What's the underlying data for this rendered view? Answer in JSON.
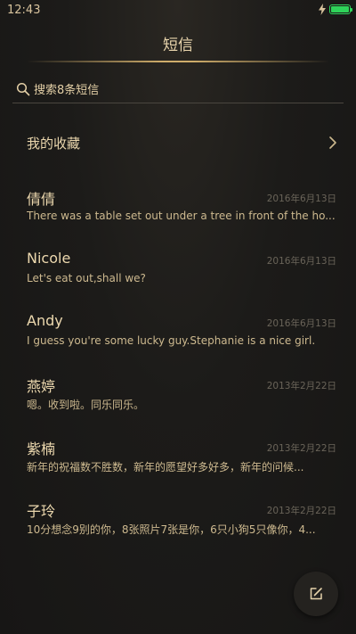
{
  "status_bar": {
    "time": "12:43",
    "battery_level": 1.0,
    "charging": true,
    "battery_color": "#2fd35a"
  },
  "header": {
    "title": "短信"
  },
  "search": {
    "placeholder": "搜索8条短信",
    "icon": "search-icon"
  },
  "favorites": {
    "label": "我的收藏",
    "icon": "chevron-right-icon"
  },
  "messages": [
    {
      "sender": "倩倩",
      "date": "2016年6月13日",
      "preview": "There was a table set out under a tree in front of the ho..."
    },
    {
      "sender": "Nicole",
      "date": "2016年6月13日",
      "preview": "Let's eat out,shall we?"
    },
    {
      "sender": "Andy",
      "date": "2016年6月13日",
      "preview": "I guess you're some lucky guy.Stephanie is a nice girl."
    },
    {
      "sender": "燕婷",
      "date": "2013年2月22日",
      "preview": "嗯。收到啦。同乐同乐。"
    },
    {
      "sender": "紫楠",
      "date": "2013年2月22日",
      "preview": "新年的祝福数不胜数，新年的愿望好多好多，新年的问候..."
    },
    {
      "sender": "子玲",
      "date": "2013年2月22日",
      "preview": "10分想念9别的你，8张照片7张是你，6只小狗5只像你，4..."
    }
  ],
  "compose": {
    "icon": "compose-icon"
  },
  "colors": {
    "accent": "#e6cfa0",
    "background": "#1b1a18",
    "date_text": "#6a6459"
  }
}
